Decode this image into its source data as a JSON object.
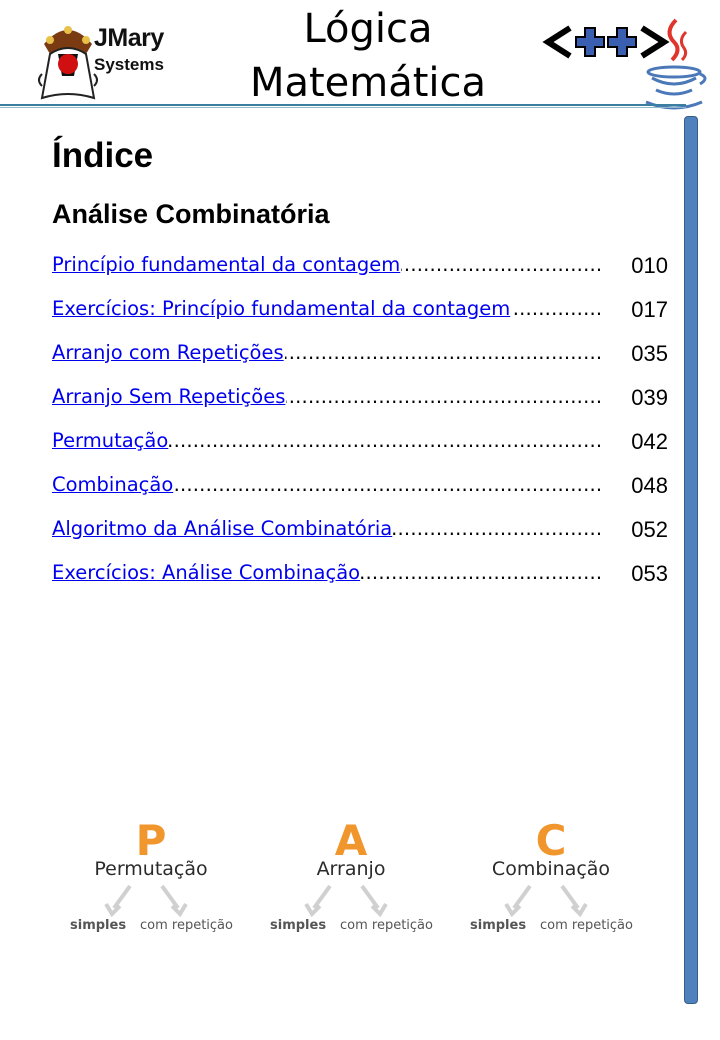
{
  "header": {
    "brand_name": "JMary",
    "brand_sub": "Systems",
    "title_line1": "Lógica",
    "title_line2": "Matemática",
    "cpp_logo_name": "cpp-logo-icon",
    "java_logo_name": "java-cup-icon"
  },
  "content": {
    "index_title": "Índice",
    "section_title": "Análise Combinatória",
    "entries": [
      {
        "label": "Princípio fundamental da contagem",
        "page": "010"
      },
      {
        "label": "Exercícios: Princípio fundamental da contagem ",
        "page": "017"
      },
      {
        "label": "Arranjo com Repetições",
        "page": "035"
      },
      {
        "label": "Arranjo Sem Repetições",
        "page": "039"
      },
      {
        "label": "Permutação",
        "page": "042"
      },
      {
        "label": "Combinação",
        "page": "048"
      },
      {
        "label": "Algoritmo da Análise Combinatória",
        "page": "052"
      },
      {
        "label": "Exercícios: Análise Combinação",
        "page": "053"
      }
    ]
  },
  "diagram": {
    "items": [
      {
        "letter": "P",
        "name": "Permutação",
        "left": "simples",
        "right": "com repetição"
      },
      {
        "letter": "A",
        "name": "Arranjo",
        "left": "simples",
        "right": "com repetição"
      },
      {
        "letter": "C",
        "name": "Combinação",
        "left": "simples",
        "right": "com repetição"
      }
    ]
  },
  "colors": {
    "link": "#0000ee",
    "accent_orange": "#f0962c",
    "side_bar": "#4f81bd",
    "header_rule": "#3a7fa0"
  }
}
